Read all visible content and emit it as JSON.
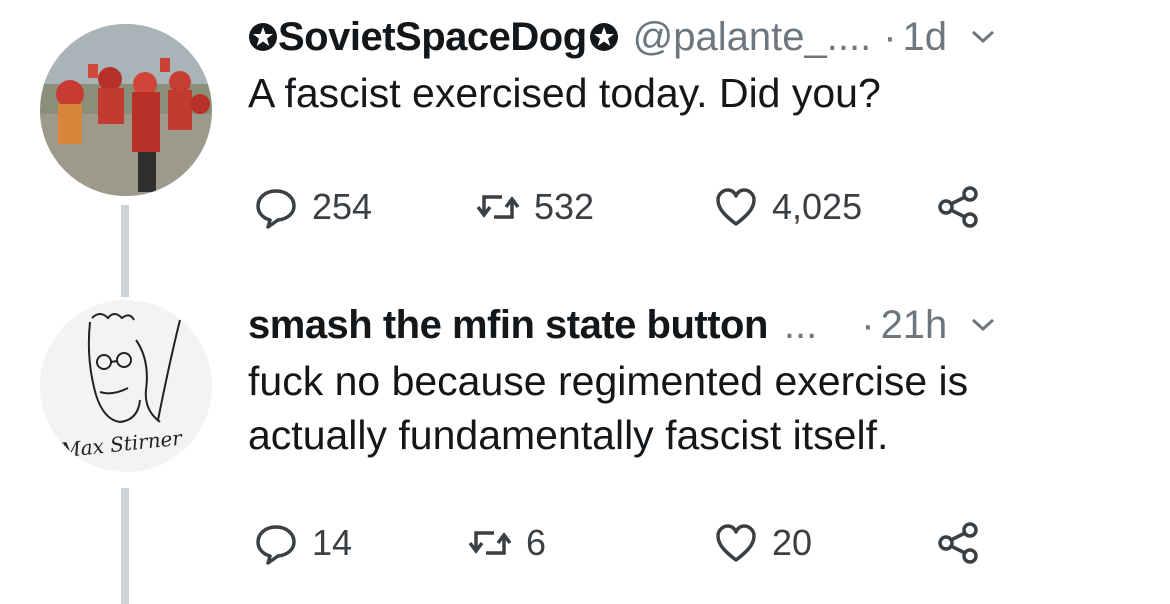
{
  "tweets": [
    {
      "name": "SovietSpaceDog",
      "handle": "@palante_....",
      "separator": "·",
      "time": "1d",
      "text": "A fascist exercised today. Did you?",
      "replies": "254",
      "retweets": "532",
      "likes": "4,025"
    },
    {
      "name": "smash the mfin state button",
      "name_ellipsis": "...",
      "separator": "·",
      "time": "21h",
      "text_line1": "fuck no because regimented exercise is",
      "text_line2": "actually fundamentally fascist itself.",
      "replies": "14",
      "retweets": "6",
      "likes": "20",
      "avatar_signature": "Max Stirner"
    }
  ],
  "colors": {
    "text": "#14171a",
    "secondary": "#6e767d",
    "thread_line": "#cfd4d8",
    "icon": "#3a3f44"
  }
}
